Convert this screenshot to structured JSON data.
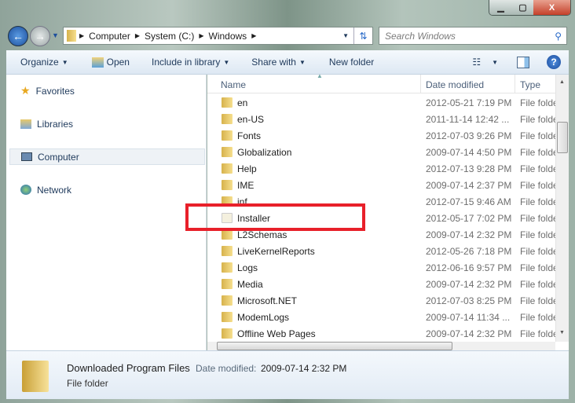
{
  "window": {
    "min": "▁",
    "max": "▢",
    "close": "X"
  },
  "address": {
    "crumbs": [
      "Computer",
      "System (C:)",
      "Windows"
    ]
  },
  "search": {
    "placeholder": "Search Windows"
  },
  "toolbar": {
    "organize": "Organize",
    "open": "Open",
    "include": "Include in library",
    "share": "Share with",
    "new_folder": "New folder",
    "help": "?"
  },
  "nav": {
    "favorites": "Favorites",
    "libraries": "Libraries",
    "computer": "Computer",
    "network": "Network"
  },
  "columns": {
    "name": "Name",
    "date": "Date modified",
    "type": "Type"
  },
  "files": [
    {
      "name": "en",
      "date": "2012-05-21 7:19 PM",
      "type": "File folder"
    },
    {
      "name": "en-US",
      "date": "2011-11-14 12:42 ...",
      "type": "File folder"
    },
    {
      "name": "Fonts",
      "date": "2012-07-03 9:26 PM",
      "type": "File folder"
    },
    {
      "name": "Globalization",
      "date": "2009-07-14 4:50 PM",
      "type": "File folder"
    },
    {
      "name": "Help",
      "date": "2012-07-13 9:28 PM",
      "type": "File folder"
    },
    {
      "name": "IME",
      "date": "2009-07-14 2:37 PM",
      "type": "File folder"
    },
    {
      "name": "inf",
      "date": "2012-07-15 9:46 AM",
      "type": "File folder"
    },
    {
      "name": "Installer",
      "date": "2012-05-17 7:02 PM",
      "type": "File folder"
    },
    {
      "name": "L2Schemas",
      "date": "2009-07-14 2:32 PM",
      "type": "File folder"
    },
    {
      "name": "LiveKernelReports",
      "date": "2012-05-26 7:18 PM",
      "type": "File folder"
    },
    {
      "name": "Logs",
      "date": "2012-06-16 9:57 PM",
      "type": "File folder"
    },
    {
      "name": "Media",
      "date": "2009-07-14 2:32 PM",
      "type": "File folder"
    },
    {
      "name": "Microsoft.NET",
      "date": "2012-07-03 8:25 PM",
      "type": "File folder"
    },
    {
      "name": "ModemLogs",
      "date": "2009-07-14 11:34 ...",
      "type": "File folder"
    },
    {
      "name": "Offline Web Pages",
      "date": "2009-07-14 2:32 PM",
      "type": "File folder"
    }
  ],
  "details": {
    "name": "Downloaded Program Files",
    "date_label": "Date modified:",
    "date": "2009-07-14 2:32 PM",
    "type": "File folder"
  },
  "colors": {
    "highlight": "#e8202a"
  }
}
